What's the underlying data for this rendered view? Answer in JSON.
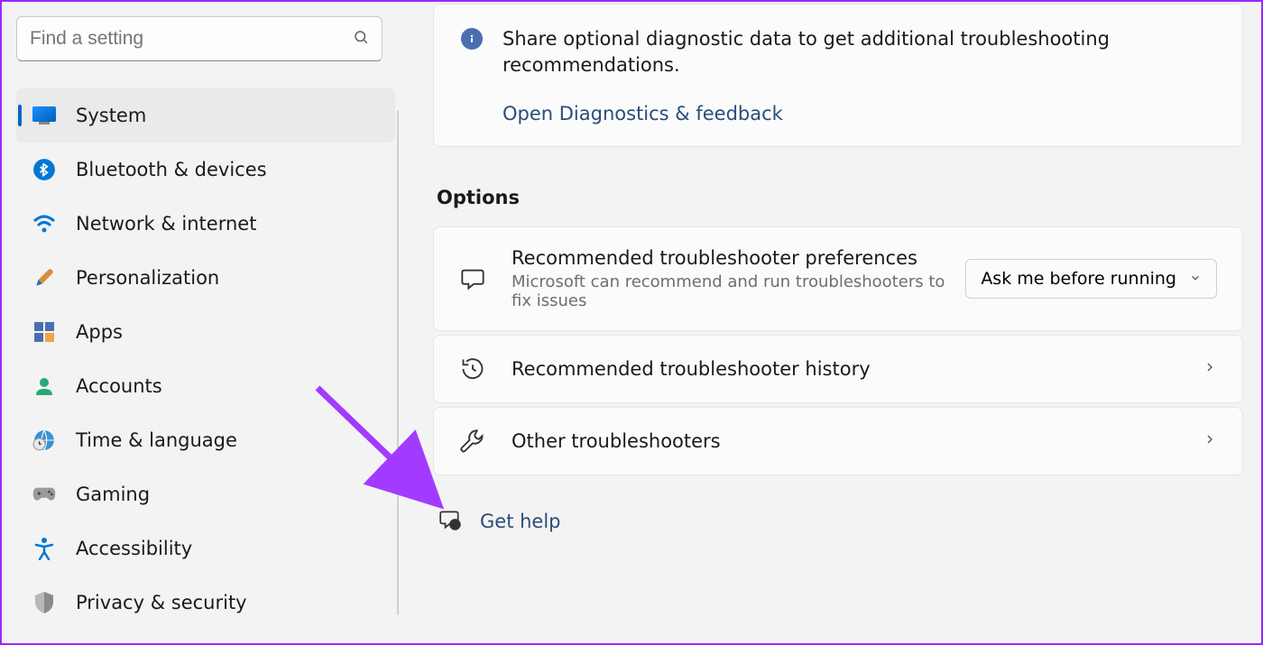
{
  "search": {
    "placeholder": "Find a setting"
  },
  "nav": [
    {
      "label": "System",
      "icon": "system",
      "active": true
    },
    {
      "label": "Bluetooth & devices",
      "icon": "bluetooth"
    },
    {
      "label": "Network & internet",
      "icon": "network"
    },
    {
      "label": "Personalization",
      "icon": "personalization"
    },
    {
      "label": "Apps",
      "icon": "apps"
    },
    {
      "label": "Accounts",
      "icon": "accounts"
    },
    {
      "label": "Time & language",
      "icon": "time"
    },
    {
      "label": "Gaming",
      "icon": "gaming"
    },
    {
      "label": "Accessibility",
      "icon": "accessibility"
    },
    {
      "label": "Privacy & security",
      "icon": "privacy"
    }
  ],
  "info": {
    "text": "Share optional diagnostic data to get additional troubleshooting recommendations.",
    "link": "Open Diagnostics & feedback"
  },
  "section_title": "Options",
  "opt_pref": {
    "title": "Recommended troubleshooter preferences",
    "sub": "Microsoft can recommend and run troubleshooters to fix issues",
    "selected": "Ask me before running"
  },
  "opt_history": {
    "title": "Recommended troubleshooter history"
  },
  "opt_other": {
    "title": "Other troubleshooters"
  },
  "help": {
    "label": "Get help"
  }
}
